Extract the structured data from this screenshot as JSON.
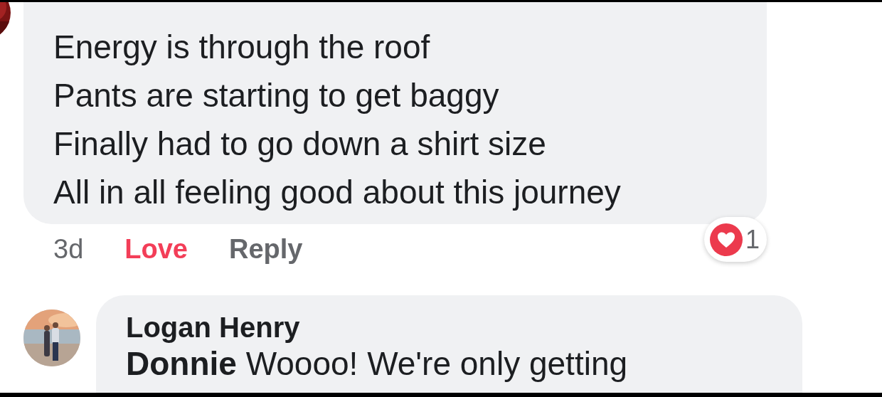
{
  "comments": [
    {
      "lines": [
        "Energy is through the roof",
        "Pants are starting to get baggy",
        "Finally had to go down a shirt size",
        "All in all feeling good about this journey"
      ],
      "time": "3d",
      "actions": [
        {
          "label": "Love",
          "selected": true
        },
        {
          "label": "Reply",
          "selected": false
        }
      ],
      "reaction_count": "1"
    },
    {
      "author": "Logan Henry",
      "lines": [
        "**Donnie** Woooo! We're only getting"
      ]
    }
  ]
}
